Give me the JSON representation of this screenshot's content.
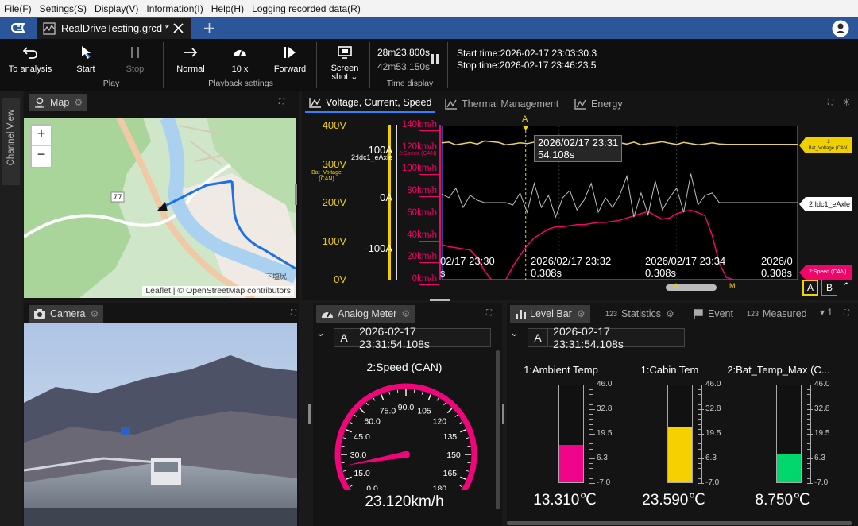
{
  "menu": [
    "File(F)",
    "Settings(S)",
    "Display(V)",
    "Information(I)",
    "Help(H)",
    "Logging recorded data(R)"
  ],
  "tab": {
    "title": "RealDriveTesting.grcd *"
  },
  "toolbar": {
    "to_analysis": "To analysis",
    "start": "Start",
    "stop": "Stop",
    "normal": "Normal",
    "speed": "10 x",
    "forward": "Forward",
    "screenshot_1": "Screen",
    "screenshot_2": "shot",
    "group_play": "Play",
    "group_playback": "Playback settings",
    "group_time": "Time display",
    "elapsed": "28m23.800s",
    "remaining": "42m53.150s",
    "start_time": "Start time:2026-02-17 23:03:30.3",
    "stop_time": "Stop time:2026-02-17 23:46:23.5"
  },
  "channel_view": "Channel View",
  "map": {
    "title": "Map",
    "attribution": "Leaflet | © OpenStreetMap contributors",
    "zoom_in": "+",
    "zoom_out": "−",
    "road_number": "77",
    "place_label": "下塩尻"
  },
  "chart_tabs": {
    "active": "Voltage, Current, Speed",
    "tab2": "Thermal Management",
    "tab3": "Energy"
  },
  "chart": {
    "volt_ticks": [
      "400V",
      "300V",
      "200V",
      "100V",
      "0V"
    ],
    "volt_series_label": "Bat_Voltage (CAN)",
    "volt_series_index": "2",
    "current_ticks": [
      "100A",
      "0A",
      "-100A"
    ],
    "current_series_label": "2:Idc1_eAxle",
    "speed_ticks": [
      "140km/h",
      "120km/h",
      "100km/h",
      "80km/h",
      "60km/h",
      "40km/h",
      "20km/h",
      "0km/h"
    ],
    "speed_series_label": "2:Speed (CAN)",
    "cursor_label": "A",
    "cursor_time_1": "2026/02/17 23:31",
    "cursor_time_2": "54.108s",
    "x_ticks": [
      {
        "l1": "02/17 23:30",
        "l2": "s"
      },
      {
        "l1": "2026/02/17 23:32",
        "l2": "0.308s"
      },
      {
        "l1": "2026/02/17 23:34",
        "l2": "0.308s"
      },
      {
        "l1": "2026/0",
        "l2": "0.308s"
      }
    ],
    "marker_volt_1": "2",
    "marker_volt_2": "Bat_Voltage (CAN)",
    "marker_current": "2:Idc1_eAxle",
    "marker_speed": "2:Speed (CAN)",
    "btn_a": "A",
    "btn_b": "B",
    "scroll_a": "A",
    "scroll_m": "M"
  },
  "chart_data": {
    "type": "line",
    "x_range": [
      "23:29:20",
      "23:35:20"
    ],
    "series": [
      {
        "name": "2:Speed (CAN)",
        "unit": "km/h",
        "ylim": [
          0,
          140
        ],
        "values": [
          32,
          30,
          29,
          28,
          27,
          20,
          8,
          0,
          0,
          0,
          12,
          22,
          31,
          38,
          42,
          46,
          48,
          48,
          49,
          50,
          50,
          51,
          52,
          52,
          53,
          54,
          56,
          58,
          60,
          62,
          58,
          55,
          56,
          60,
          62,
          63,
          61,
          58,
          40,
          15,
          2,
          0,
          0,
          0,
          0,
          0,
          0,
          0,
          0,
          0,
          0
        ]
      },
      {
        "name": "2:Idc1_eAxle",
        "unit": "A",
        "ylim": [
          -160,
          160
        ],
        "values": [
          18,
          10,
          30,
          -10,
          15,
          5,
          0,
          0,
          0,
          0,
          -5,
          20,
          -20,
          40,
          -10,
          15,
          -30,
          10,
          25,
          -15,
          5,
          40,
          -20,
          10,
          -10,
          15,
          55,
          -30,
          20,
          -25,
          45,
          -15,
          10,
          30,
          -20,
          60,
          -5,
          15,
          20,
          0,
          0,
          0,
          0,
          0,
          0,
          0,
          0,
          0,
          0,
          0,
          0
        ]
      },
      {
        "name": "Bat_Voltage (CAN)",
        "unit": "V",
        "ylim": [
          0,
          400
        ],
        "values": [
          355,
          357,
          350,
          353,
          356,
          352,
          360,
          358,
          356,
          350,
          352,
          355,
          353,
          357,
          351,
          354,
          356,
          352,
          350,
          355,
          357,
          353,
          356,
          349,
          351,
          355,
          352,
          357,
          350,
          353,
          355,
          358,
          354,
          351,
          356,
          353,
          350,
          352,
          355,
          352,
          351,
          351,
          351,
          351,
          351,
          351,
          351,
          351,
          351,
          351,
          351
        ]
      }
    ]
  },
  "camera": {
    "title": "Camera"
  },
  "analog": {
    "title": "Analog Meter",
    "time_label": "A",
    "time": "2026-02-17 23:31:54.108s",
    "channel": "2:Speed (CAN)",
    "value": "23.120km/h",
    "speed": 23.12,
    "max": 180,
    "ticks": [
      "0.0",
      "15.0",
      "30.0",
      "45.0",
      "60.0",
      "75.0",
      "90.0",
      "105",
      "120",
      "135",
      "150",
      "165",
      "180"
    ]
  },
  "level": {
    "title": "Level Bar",
    "tab_statistics": "Statistics",
    "tab_event": "Event",
    "tab_measured": "Measured",
    "tab_measured_prefix": "123",
    "tab_count": "1",
    "time_label": "A",
    "time": "2026-02-17 23:31:54.108s",
    "ticks": [
      "46.0",
      "32.8",
      "19.5",
      "6.3",
      "-7.0"
    ],
    "bars": [
      {
        "label": "1:Ambient Temp",
        "value": "13.310℃",
        "num": 13.31,
        "color": "#f0058a"
      },
      {
        "label": "1:Cabin Tem",
        "value": "23.590℃",
        "num": 23.59,
        "color": "#f6d000"
      },
      {
        "label": "2:Bat_Temp_Max (C...",
        "value": "8.750℃",
        "num": 8.75,
        "color": "#00d66c"
      }
    ],
    "range": [
      -7.0,
      46.0
    ]
  }
}
